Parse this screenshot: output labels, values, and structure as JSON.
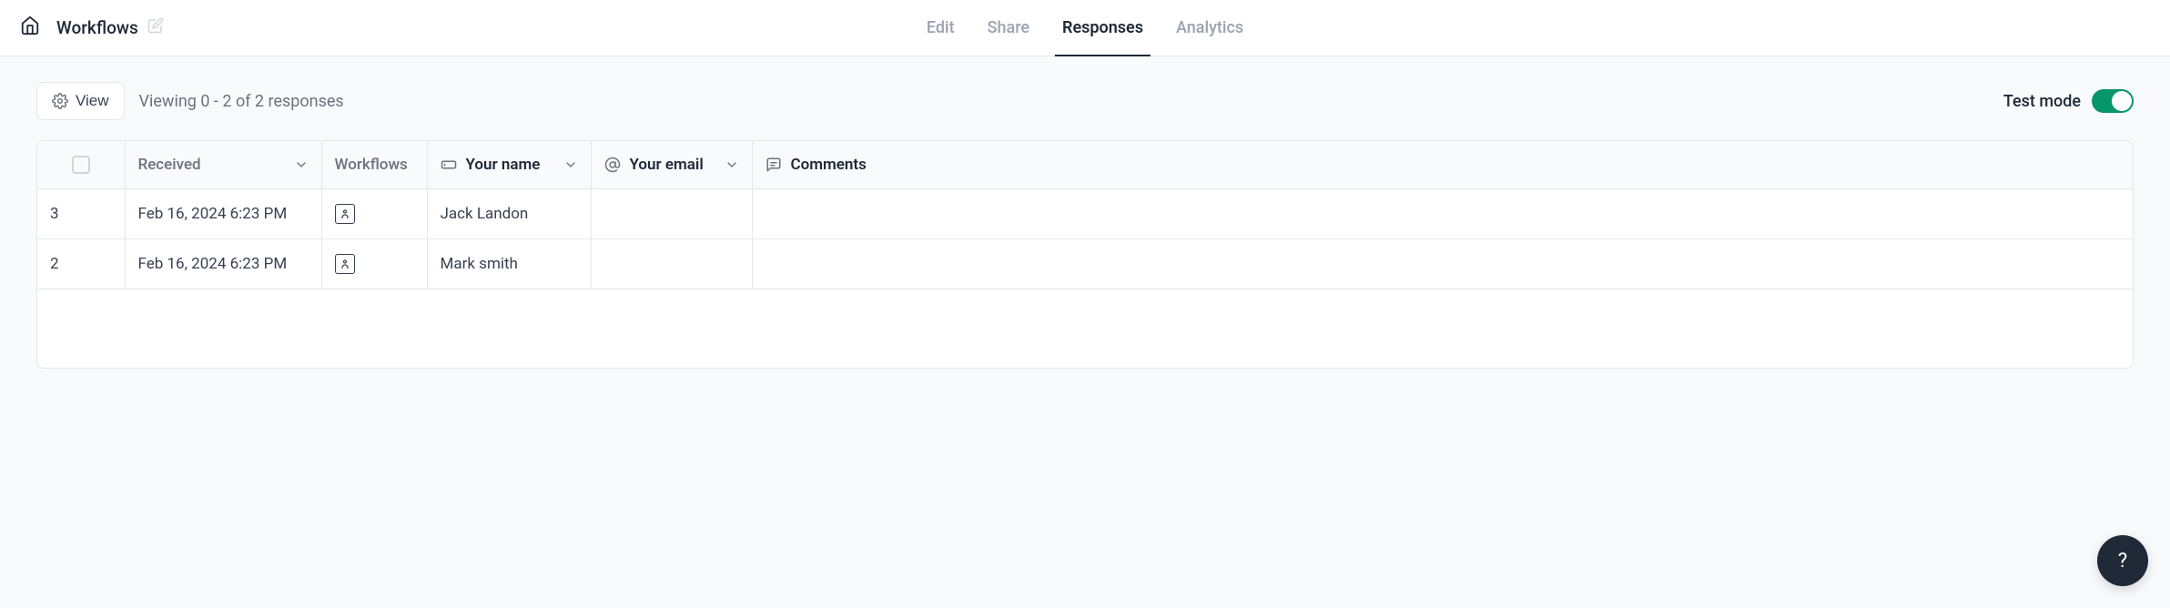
{
  "header": {
    "title": "Workflows",
    "tabs": [
      {
        "label": "Edit",
        "active": false
      },
      {
        "label": "Share",
        "active": false
      },
      {
        "label": "Responses",
        "active": true
      },
      {
        "label": "Analytics",
        "active": false
      }
    ]
  },
  "toolbar": {
    "view_button": "View",
    "viewing_text": "Viewing 0 - 2 of 2 responses",
    "test_mode_label": "Test mode",
    "test_mode_on": true
  },
  "table": {
    "columns": {
      "received": "Received",
      "workflows": "Workflows",
      "your_name": "Your name",
      "your_email": "Your email",
      "comments": "Comments"
    },
    "rows": [
      {
        "id": "3",
        "received": "Feb 16, 2024 6:23 PM",
        "name": "Jack Landon",
        "email": "",
        "comments": ""
      },
      {
        "id": "2",
        "received": "Feb 16, 2024 6:23 PM",
        "name": "Mark smith",
        "email": "",
        "comments": ""
      }
    ]
  },
  "help_fab": "?"
}
